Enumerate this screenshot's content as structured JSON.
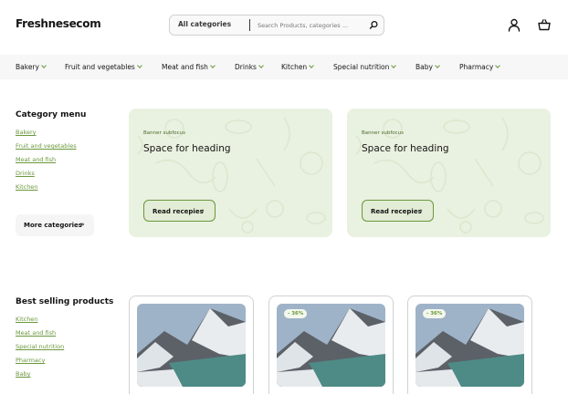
{
  "header": {
    "logo": "Freshnesecom",
    "search": {
      "category_label": "All categories",
      "placeholder": "Search Products, categories ..."
    },
    "icons": [
      "user-icon",
      "basket-icon",
      "search-icon"
    ]
  },
  "nav": {
    "items": [
      {
        "label": "Bakery"
      },
      {
        "label": "Fruit and vegetables"
      },
      {
        "label": "Meat and fish"
      },
      {
        "label": "Drinks"
      },
      {
        "label": "Kitchen"
      },
      {
        "label": "Special nutrition"
      },
      {
        "label": "Baby"
      },
      {
        "label": "Pharmacy"
      }
    ]
  },
  "category_menu": {
    "title": "Category menu",
    "links": [
      "Bakery",
      "Fruit and vegetables",
      "Meat and fish",
      "Drinks",
      "Kitchen"
    ],
    "more_button": "More categories"
  },
  "banners": [
    {
      "subfocus": "Banner subfocus",
      "heading": "Space for heading",
      "button": "Read recepies"
    },
    {
      "subfocus": "Banner subfocus",
      "heading": "Space for heading",
      "button": "Read recepies"
    }
  ],
  "best_selling": {
    "title": "Best selling products",
    "links": [
      "Kitchen",
      "Meat and fish",
      "Special nutrition",
      "Pharmacy",
      "Baby"
    ]
  },
  "products": [
    {
      "badge": ""
    },
    {
      "badge": "- 36%"
    },
    {
      "badge": "- 36%"
    }
  ],
  "colors": {
    "accent": "#6a983c",
    "banner_bg": "#e9f1e0",
    "text": "#151515"
  }
}
